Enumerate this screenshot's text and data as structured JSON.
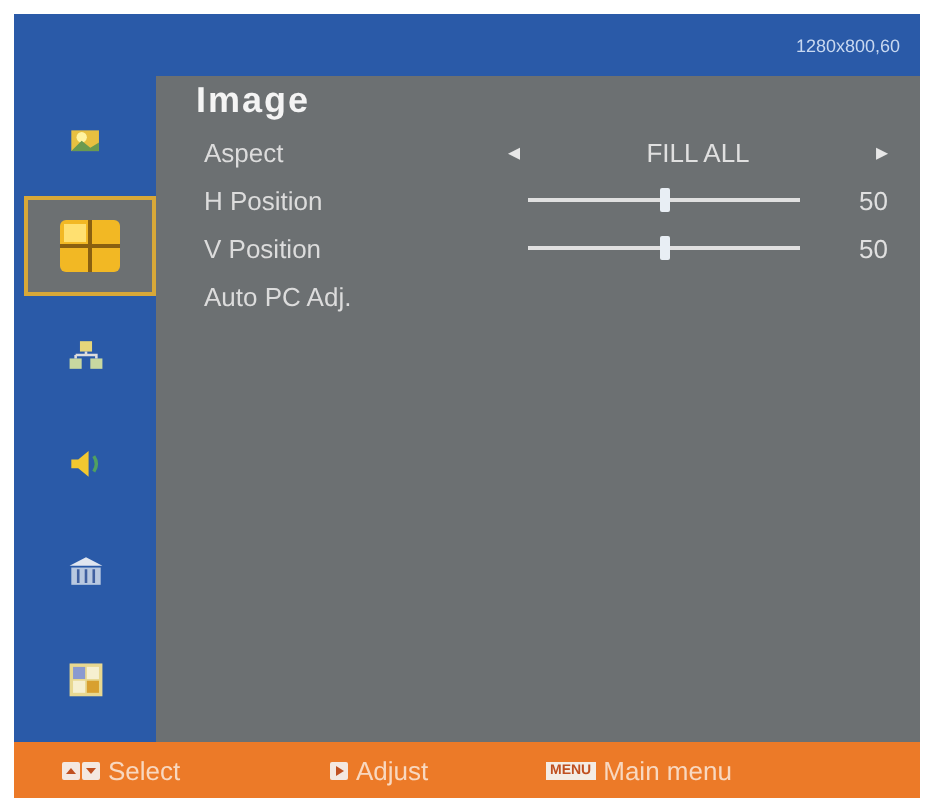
{
  "status": "1280x800,60",
  "sidebar": {
    "items": [
      {
        "kind": "picture",
        "selected": false
      },
      {
        "kind": "image",
        "selected": true
      },
      {
        "kind": "network",
        "selected": false
      },
      {
        "kind": "audio",
        "selected": false
      },
      {
        "kind": "building",
        "selected": false
      },
      {
        "kind": "language",
        "selected": false
      }
    ]
  },
  "panel": {
    "title": "Image",
    "rows": [
      {
        "kind": "select",
        "label": "Aspect",
        "value": "FILL ALL",
        "prev": "◂",
        "next": "▸"
      },
      {
        "kind": "slider",
        "label": "H Position",
        "level": 0.5,
        "reading": "50"
      },
      {
        "kind": "slider",
        "label": "V Position",
        "level": 0.5,
        "reading": "50"
      },
      {
        "kind": "action",
        "label": "Auto PC Adj."
      }
    ]
  },
  "footer": {
    "hints": [
      {
        "kind": "updown",
        "label": "Select"
      },
      {
        "kind": "right",
        "label": "Adjust"
      },
      {
        "kind": "menu",
        "key_text": "MENU",
        "label": "Main menu"
      }
    ]
  }
}
